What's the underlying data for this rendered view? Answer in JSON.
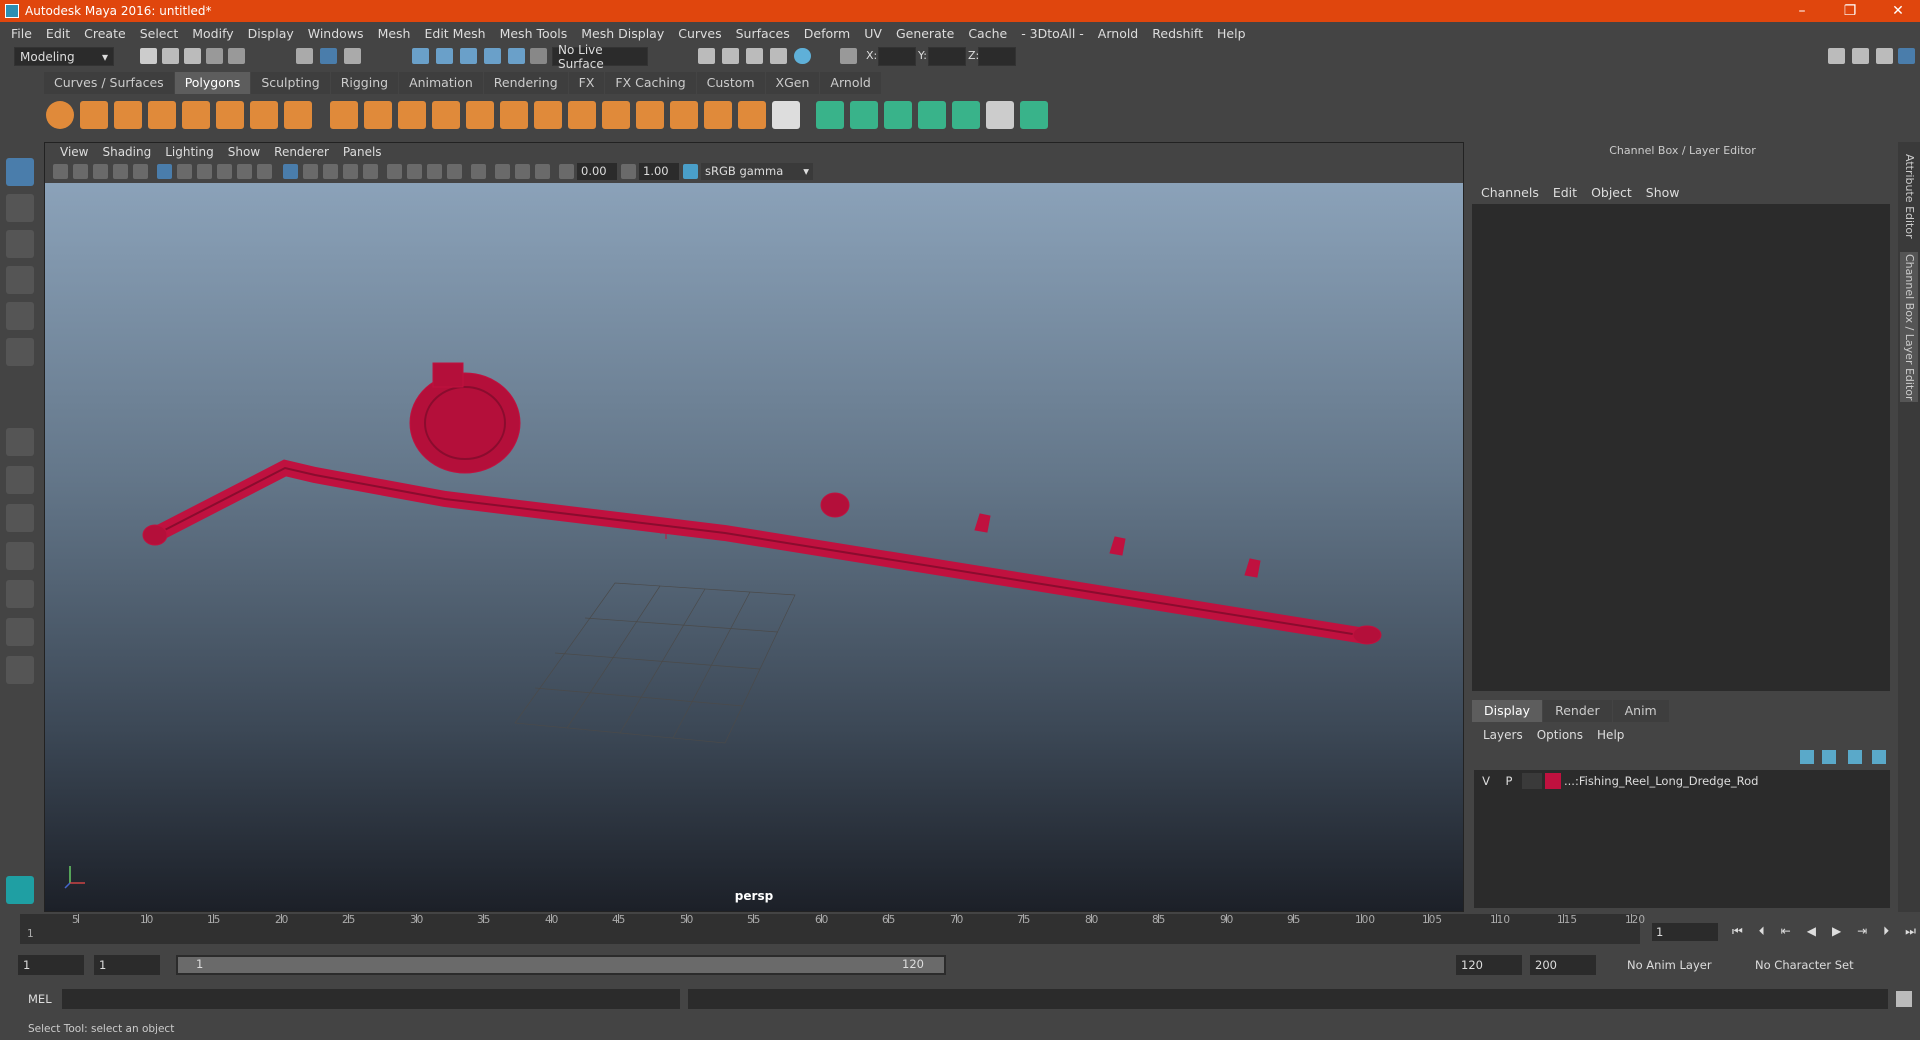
{
  "window": {
    "title": "Autodesk Maya 2016: untitled*"
  },
  "menubar": [
    "File",
    "Edit",
    "Create",
    "Select",
    "Modify",
    "Display",
    "Windows",
    "Mesh",
    "Edit Mesh",
    "Mesh Tools",
    "Mesh Display",
    "Curves",
    "Surfaces",
    "Deform",
    "UV",
    "Generate",
    "Cache",
    "- 3DtoAll -",
    "Arnold",
    "Redshift",
    "Help"
  ],
  "statusline": {
    "mode": "Modeling",
    "live_surface": "No Live Surface",
    "x_label": "X:",
    "y_label": "Y:",
    "z_label": "Z:"
  },
  "shelf_tabs": [
    "Curves / Surfaces",
    "Polygons",
    "Sculpting",
    "Rigging",
    "Animation",
    "Rendering",
    "FX",
    "FX Caching",
    "Custom",
    "XGen",
    "Arnold"
  ],
  "active_shelf_tab": "Polygons",
  "panel_menu": [
    "View",
    "Shading",
    "Lighting",
    "Show",
    "Renderer",
    "Panels"
  ],
  "panel_toolbar": {
    "exposure": "0.00",
    "gamma": "1.00",
    "color_space": "sRGB gamma"
  },
  "viewport": {
    "camera": "persp",
    "model_color": "#c0113f"
  },
  "right_panel": {
    "title": "Channel Box / Layer Editor",
    "menu": [
      "Channels",
      "Edit",
      "Object",
      "Show"
    ],
    "tabs": [
      "Display",
      "Render",
      "Anim"
    ],
    "active_tab": "Display",
    "layer_menu": [
      "Layers",
      "Options",
      "Help"
    ],
    "layers": [
      {
        "v": "V",
        "p": "P",
        "color": "#c0113f",
        "name": "...:Fishing_Reel_Long_Dredge_Rod"
      }
    ]
  },
  "side_tabs": [
    "Attribute Editor",
    "Channel Box / Layer Editor"
  ],
  "time_slider": {
    "ticks": [
      "5",
      "10",
      "15",
      "20",
      "25",
      "30",
      "35",
      "40",
      "45",
      "50",
      "55",
      "60",
      "65",
      "70",
      "75",
      "80",
      "85",
      "90",
      "95",
      "100",
      "105",
      "110",
      "115",
      "120"
    ],
    "start_label": "1",
    "current_frame": "1"
  },
  "range_slider": {
    "start": "1",
    "start2": "1",
    "range_start": "1",
    "range_end": "120",
    "end": "120",
    "end2": "200",
    "anim_layer": "No Anim Layer",
    "character_set": "No Character Set"
  },
  "command_line": {
    "label": "MEL"
  },
  "help_line": "Select Tool: select an object"
}
